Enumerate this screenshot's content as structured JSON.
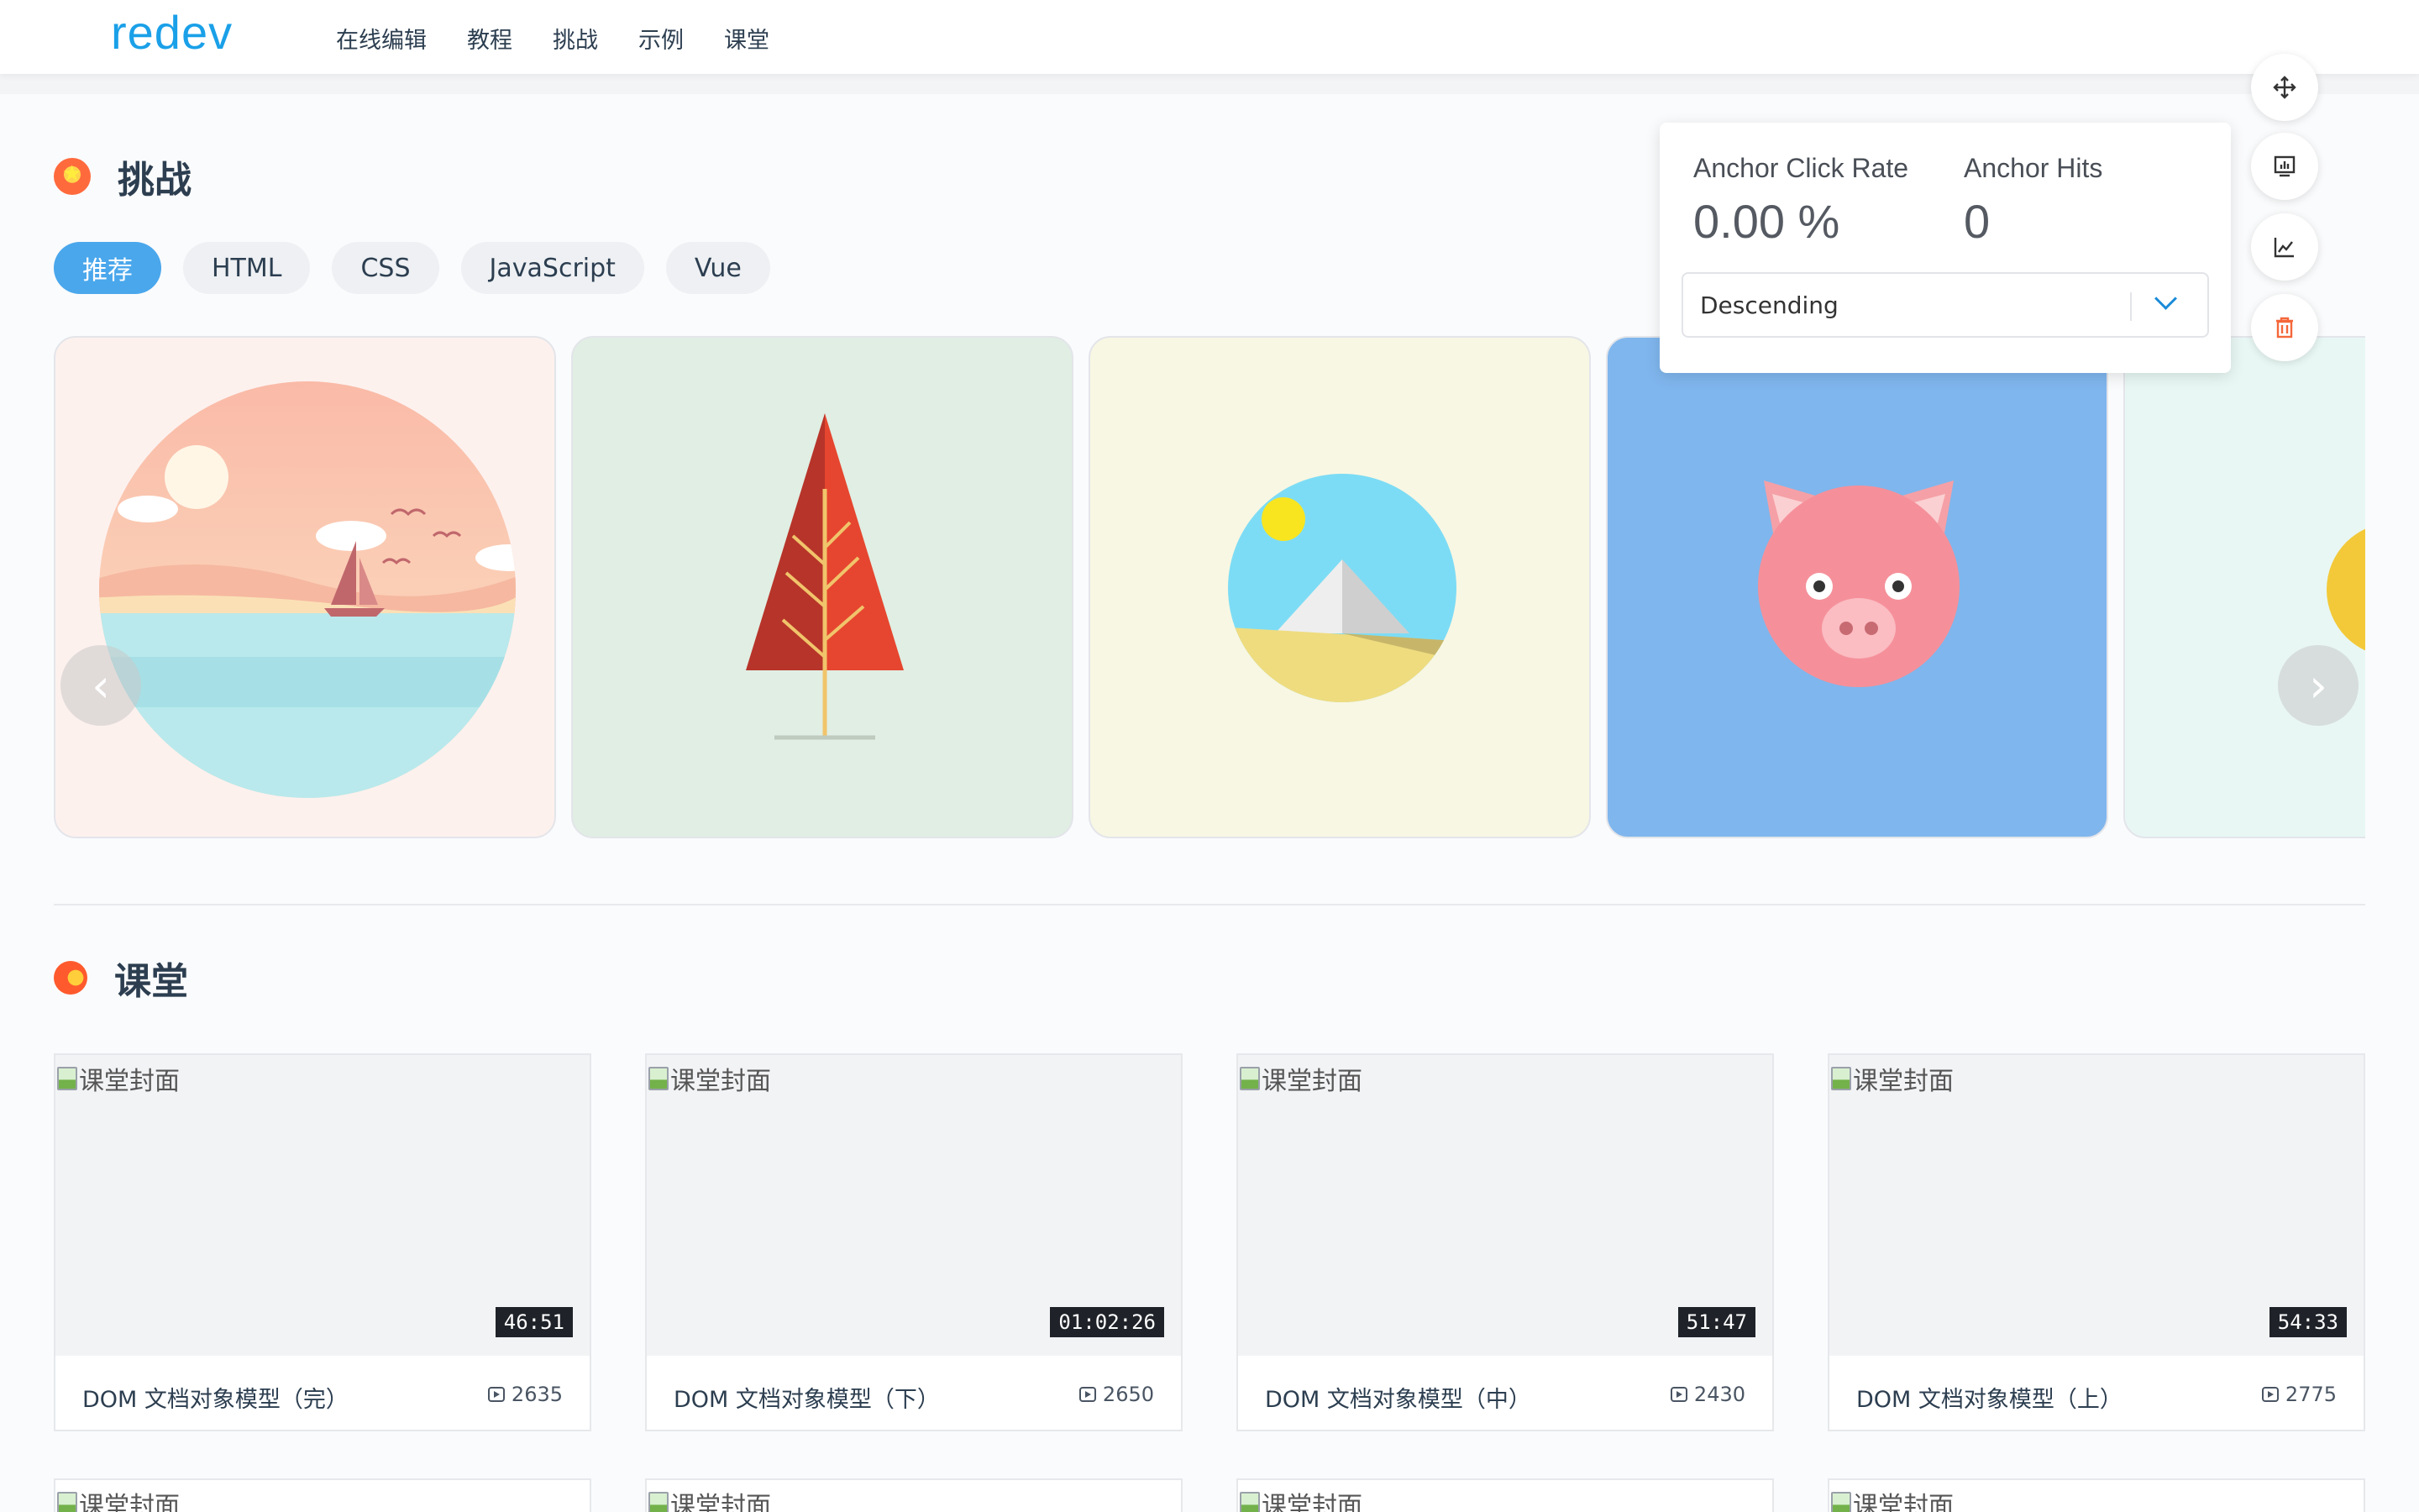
{
  "header": {
    "logo": "redev",
    "nav": [
      "在线编辑",
      "教程",
      "挑战",
      "示例",
      "课堂"
    ]
  },
  "challenge": {
    "title": "挑战",
    "filters": [
      "推荐",
      "HTML",
      "CSS",
      "JavaScript",
      "Vue"
    ],
    "active_filter": "推荐",
    "cards": [
      {
        "name": "sunset-sea",
        "bg": "#fdf1ee"
      },
      {
        "name": "red-tree",
        "bg": "#e0eee3"
      },
      {
        "name": "desert-pyramid",
        "bg": "#f8f7e3"
      },
      {
        "name": "pig-face",
        "bg": "#7fb6ed"
      },
      {
        "name": "partial-card",
        "bg": "#e8f7f4"
      }
    ],
    "prev_icon": "chevron-left-icon",
    "next_icon": "chevron-right-icon"
  },
  "classroom": {
    "title": "课堂",
    "cover_alt": "课堂封面",
    "courses": [
      {
        "title": "DOM 文档对象模型（完）",
        "duration": "46:51",
        "views": "2635"
      },
      {
        "title": "DOM 文档对象模型（下）",
        "duration": "01:02:26",
        "views": "2650"
      },
      {
        "title": "DOM 文档对象模型（中）",
        "duration": "51:47",
        "views": "2430"
      },
      {
        "title": "DOM 文档对象模型（上）",
        "duration": "54:33",
        "views": "2775"
      }
    ]
  },
  "anchor": {
    "click_rate_label": "Anchor Click Rate",
    "click_rate_value": "0.00 %",
    "hits_label": "Anchor Hits",
    "hits_value": "0",
    "sort_value": "Descending"
  },
  "tools": [
    "move-icon",
    "report-icon",
    "chart-icon",
    "trash-icon"
  ],
  "colors": {
    "brand": "#1aa0e8",
    "active_chip": "#4aa7ec",
    "trash": "#f5673a"
  }
}
